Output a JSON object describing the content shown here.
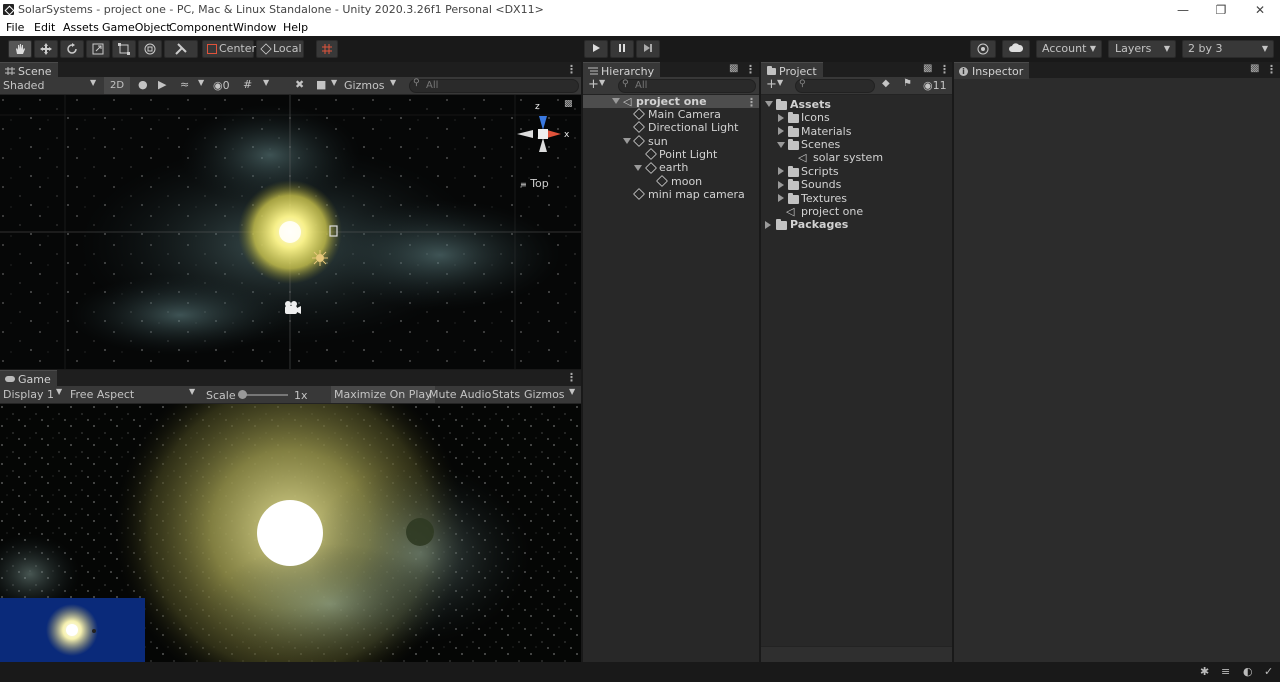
{
  "window": {
    "title": "SolarSystems - project one - PC, Mac & Linux Standalone - Unity 2020.3.26f1 Personal <DX11>"
  },
  "menu": [
    "File",
    "Edit",
    "Assets",
    "GameObject",
    "Component",
    "Window",
    "Help"
  ],
  "toolbar": {
    "center_label": "Center",
    "local_label": "Local",
    "account_label": "Account",
    "layers_label": "Layers",
    "layout_label": "2 by 3"
  },
  "scene": {
    "tab_label": "Scene",
    "shading": "Shaded",
    "mode_2d": "2D",
    "hidden_count": "0",
    "gizmos_label": "Gizmos",
    "search_placeholder": "All",
    "view_label": "Top",
    "axis_z": "z",
    "axis_x": "x"
  },
  "game": {
    "tab_label": "Game",
    "display": "Display 1",
    "aspect": "Free Aspect",
    "scale_label": "Scale",
    "scale_value": "1x",
    "maximize_label": "Maximize On Play",
    "mute_label": "Mute Audio",
    "stats_label": "Stats",
    "gizmos_label": "Gizmos"
  },
  "hierarchy": {
    "tab_label": "Hierarchy",
    "search_placeholder": "All",
    "items": [
      {
        "label": "project one"
      },
      {
        "label": "Main Camera"
      },
      {
        "label": "Directional Light"
      },
      {
        "label": "sun"
      },
      {
        "label": "Point Light"
      },
      {
        "label": "earth"
      },
      {
        "label": "moon"
      },
      {
        "label": "mini map camera"
      }
    ]
  },
  "project": {
    "tab_label": "Project",
    "hidden_count": "11",
    "items": [
      {
        "label": "Assets"
      },
      {
        "label": "Icons"
      },
      {
        "label": "Materials"
      },
      {
        "label": "Scenes"
      },
      {
        "label": "solar system"
      },
      {
        "label": "Scripts"
      },
      {
        "label": "Sounds"
      },
      {
        "label": "Textures"
      },
      {
        "label": "project one"
      },
      {
        "label": "Packages"
      }
    ]
  },
  "inspector": {
    "tab_label": "Inspector"
  },
  "colors": {
    "accent": "#3a79bb",
    "selection": "#4d4d4d",
    "minimap_bg": "#0a2a7a"
  }
}
